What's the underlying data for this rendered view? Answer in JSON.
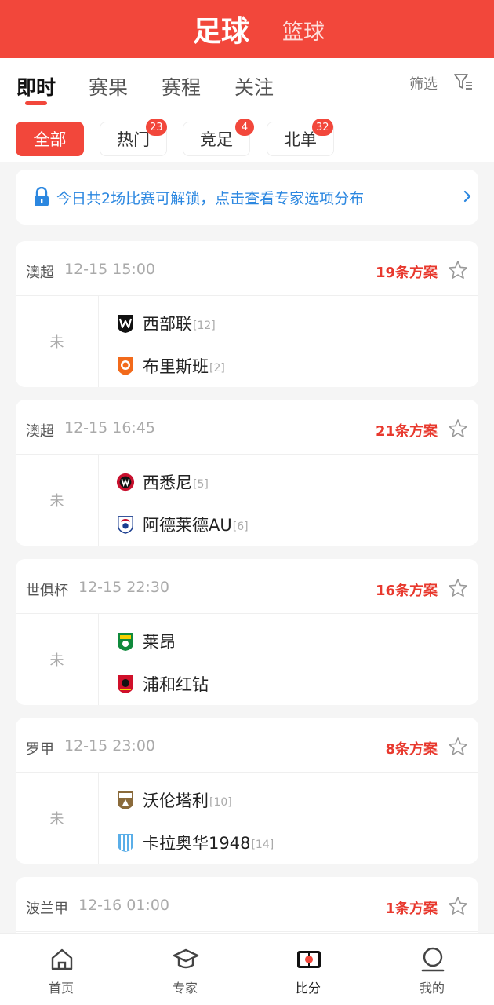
{
  "header": {
    "sport_active": "足球",
    "sport_other": "篮球"
  },
  "subtabs": {
    "items": [
      "即时",
      "赛果",
      "赛程",
      "关注"
    ],
    "filter_label": "筛选"
  },
  "chips": [
    {
      "label": "全部",
      "badge": ""
    },
    {
      "label": "热门",
      "badge": "23"
    },
    {
      "label": "竞足",
      "badge": "4"
    },
    {
      "label": "北单",
      "badge": "32"
    }
  ],
  "banner": {
    "text": "今日共2场比赛可解锁，点击查看专家选项分布"
  },
  "matches": [
    {
      "league": "澳超",
      "time": "12-15 15:00",
      "plans": "19条方案",
      "status": "未",
      "home": {
        "name": "西部联",
        "rank": "[12]",
        "logo": "western-united-logo"
      },
      "away": {
        "name": "布里斯班",
        "rank": "[2]",
        "logo": "brisbane-roar-logo"
      }
    },
    {
      "league": "澳超",
      "time": "12-15 16:45",
      "plans": "21条方案",
      "status": "未",
      "home": {
        "name": "西悉尼",
        "rank": "[5]",
        "logo": "western-sydney-logo"
      },
      "away": {
        "name": "阿德莱德AU",
        "rank": "[6]",
        "logo": "adelaide-united-logo"
      }
    },
    {
      "league": "世俱杯",
      "time": "12-15 22:30",
      "plans": "16条方案",
      "status": "未",
      "home": {
        "name": "莱昂",
        "rank": "",
        "logo": "leon-logo"
      },
      "away": {
        "name": "浦和红钻",
        "rank": "",
        "logo": "urawa-reds-logo"
      }
    },
    {
      "league": "罗甲",
      "time": "12-15 23:00",
      "plans": "8条方案",
      "status": "未",
      "home": {
        "name": "沃伦塔利",
        "rank": "[10]",
        "logo": "voluntari-logo"
      },
      "away": {
        "name": "卡拉奥华1948",
        "rank": "[14]",
        "logo": "craiova-1948-logo"
      }
    },
    {
      "league": "波兰甲",
      "time": "12-16 01:00",
      "plans": "1条方案",
      "status": "",
      "home": null,
      "away": null
    }
  ],
  "bottom_nav": [
    {
      "label": "首页",
      "icon": "home-icon"
    },
    {
      "label": "专家",
      "icon": "expert-cap-icon"
    },
    {
      "label": "比分",
      "icon": "score-board-icon"
    },
    {
      "label": "我的",
      "icon": "profile-icon"
    }
  ],
  "colors": {
    "brand": "#f2473b",
    "plans": "#e8392e",
    "banner_text": "#2b87e0"
  }
}
